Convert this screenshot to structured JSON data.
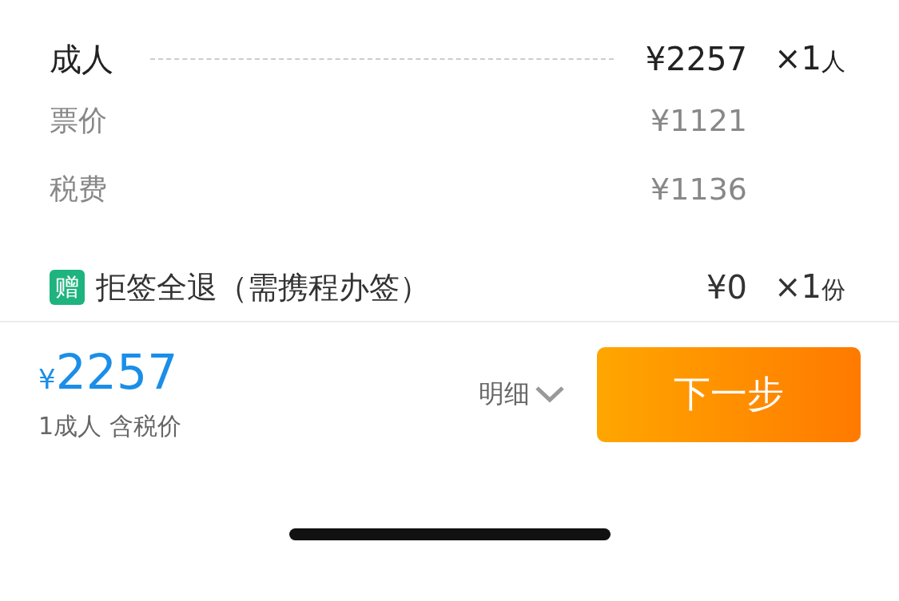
{
  "passenger": {
    "label": "成人",
    "price": "¥2257",
    "quantity": "×1",
    "unit": "人"
  },
  "breakdown": [
    {
      "label": "票价",
      "price": "¥1121"
    },
    {
      "label": "税费",
      "price": "¥1136"
    }
  ],
  "gift": {
    "badge": "赠",
    "label": "拒签全退（需携程办签）",
    "price": "¥0",
    "quantity": "×1",
    "unit": "份"
  },
  "footer": {
    "currency": "¥",
    "total": "2257",
    "note": "1成人 含税价",
    "details_label": "明细",
    "next_button": "下一步"
  }
}
